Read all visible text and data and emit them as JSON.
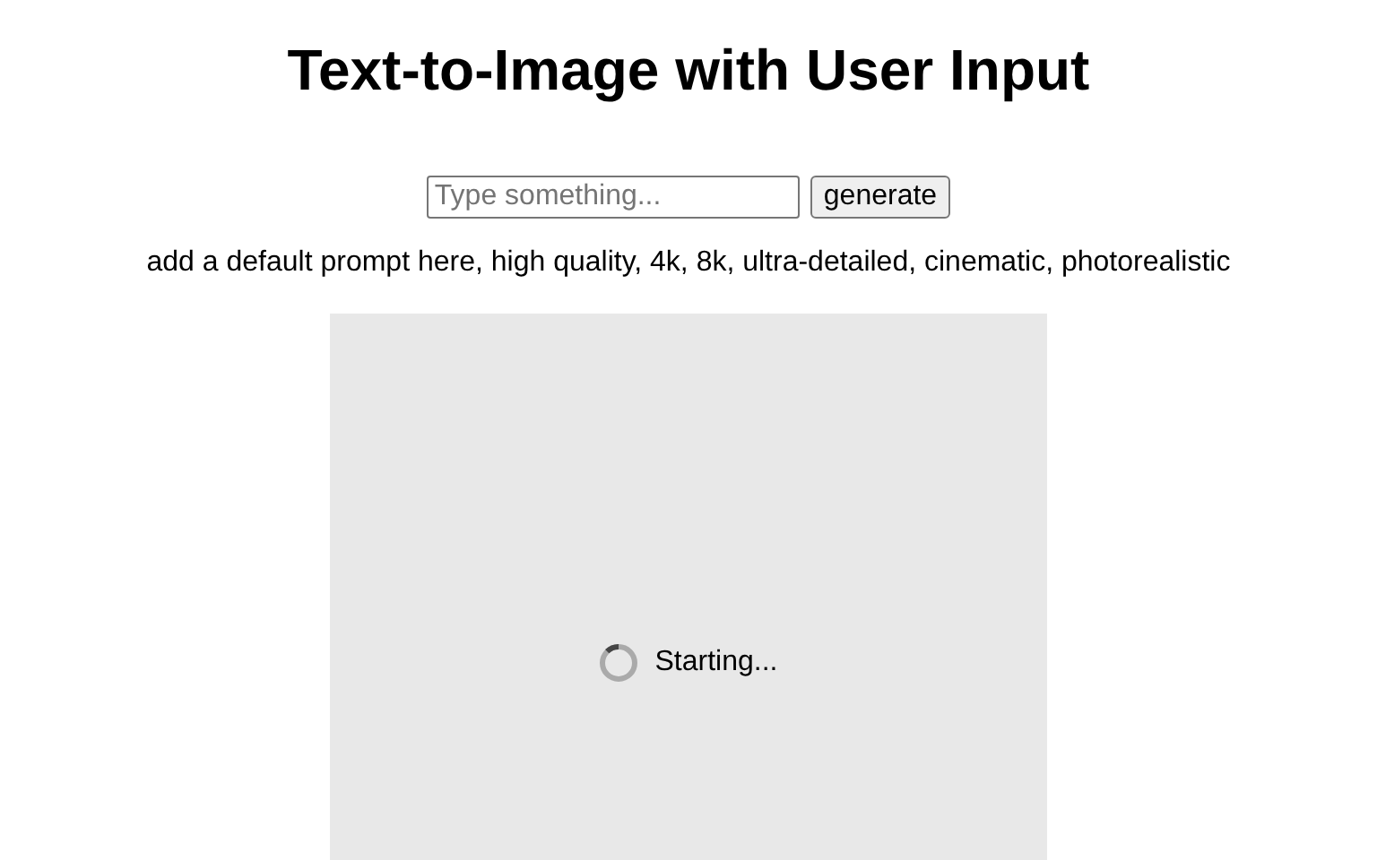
{
  "title": "Text-to-Image with User Input",
  "prompt_input": {
    "placeholder": "Type something..."
  },
  "generate_button": "generate",
  "default_prompt": "add a default prompt here, high quality, 4k, 8k, ultra-detailed, cinematic, photorealistic",
  "image_area": {
    "status": "Starting..."
  }
}
